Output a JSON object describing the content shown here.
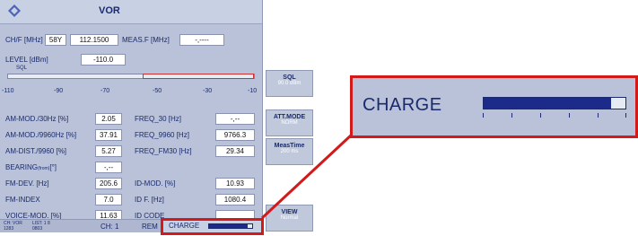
{
  "title": "VOR",
  "header": {
    "chf_label": "CH/F [MHz]",
    "chf_channel": "58Y",
    "chf_value": "112.1500",
    "measf_label": "MEAS.F [MHz]",
    "measf_value": "-,----",
    "level_label": "LEVEL [dBm]",
    "level_value": "-110.0",
    "sql_label": "SQL"
  },
  "level_bar": {
    "ticks": [
      "-110",
      "-90",
      "-70",
      "-50",
      "-30",
      "-10"
    ]
  },
  "left_params": [
    {
      "label": "AM-MOD./30Hz [%]",
      "value": "2.05"
    },
    {
      "label": "AM-MOD./9960Hz [%]",
      "value": "37.91"
    },
    {
      "label": "AM-DIST./9960 [%]",
      "value": "5.27"
    },
    {
      "label": "BEARING",
      "label_small": "(from)",
      "label_suffix": "[°]",
      "value": "-,--"
    },
    {
      "label": "FM-DEV. [Hz]",
      "value": "205.6"
    },
    {
      "label": "FM-INDEX",
      "value": "7.0"
    },
    {
      "label": "VOICE-MOD. [%]",
      "value": "11.63"
    }
  ],
  "right_params": [
    {
      "label": "FREQ_30 [Hz]",
      "value": "-,--"
    },
    {
      "label": "FREQ_9960 [Hz]",
      "value": "9766.3"
    },
    {
      "label": "FREQ_FM30 [Hz]",
      "value": "29.34"
    },
    {
      "label": "",
      "value": ""
    },
    {
      "label": "ID-MOD. [%]",
      "value": "10.93"
    },
    {
      "label": "ID F. [Hz]",
      "value": "1080.4"
    },
    {
      "label": "ID CODE",
      "value": ""
    }
  ],
  "softkeys": [
    {
      "title": "SQL",
      "sub": "90.0 dBm"
    },
    {
      "title": "ATT.MODE",
      "sub": "NORM"
    },
    {
      "title": "MeasTime",
      "sub": "200 ms"
    },
    {
      "title": "VIEW",
      "sub": "Normal"
    }
  ],
  "status": {
    "ch_info": "CH: VOR",
    "ch_info_sub": "1283",
    "list_info": "LIST: 1 8",
    "list_info_sub": "0803",
    "ch_label": "CH: 1",
    "rem_label": "REM"
  },
  "charge": {
    "label": "CHARGE",
    "level": 0.9
  },
  "colors": {
    "screen_bg": "#b9c2d8",
    "highlight": "#d21a1a",
    "bar_fill": "#1c2a8a"
  }
}
